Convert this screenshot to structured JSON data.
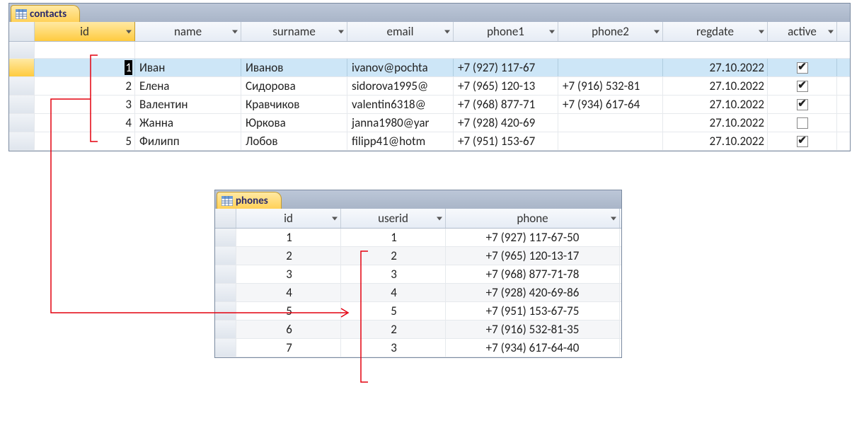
{
  "contacts": {
    "tab_label": "contacts",
    "columns": {
      "id": "id",
      "name": "name",
      "surname": "surname",
      "email": "email",
      "phone1": "phone1",
      "phone2": "phone2",
      "regdate": "regdate",
      "active": "active"
    },
    "rows": [
      {
        "id": "1",
        "name": "Иван",
        "surname": "Иванов",
        "email": "ivanov@pochta",
        "phone1": "+7 (927) 117-67",
        "phone2": "",
        "regdate": "27.10.2022",
        "active": true,
        "selected": true
      },
      {
        "id": "2",
        "name": "Елена",
        "surname": "Сидорова",
        "email": "sidorova1995@",
        "phone1": "+7 (965) 120-13",
        "phone2": "+7 (916) 532-81",
        "regdate": "27.10.2022",
        "active": true,
        "selected": false
      },
      {
        "id": "3",
        "name": "Валентин",
        "surname": "Кравчиков",
        "email": "valentin6318@",
        "phone1": "+7 (968) 877-71",
        "phone2": "+7 (934) 617-64",
        "regdate": "27.10.2022",
        "active": true,
        "selected": false
      },
      {
        "id": "4",
        "name": "Жанна",
        "surname": "Юркова",
        "email": "janna1980@yar",
        "phone1": "+7 (928) 420-69",
        "phone2": "",
        "regdate": "27.10.2022",
        "active": false,
        "selected": false
      },
      {
        "id": "5",
        "name": "Филипп",
        "surname": "Лобов",
        "email": "filipp41@hotm",
        "phone1": "+7 (951) 153-67",
        "phone2": "",
        "regdate": "27.10.2022",
        "active": true,
        "selected": false
      }
    ]
  },
  "phones": {
    "tab_label": "phones",
    "columns": {
      "id": "id",
      "userid": "userid",
      "phone": "phone"
    },
    "rows": [
      {
        "id": "1",
        "userid": "1",
        "phone": "+7 (927) 117-67-50"
      },
      {
        "id": "2",
        "userid": "2",
        "phone": "+7 (965) 120-13-17"
      },
      {
        "id": "3",
        "userid": "3",
        "phone": "+7 (968) 877-71-78"
      },
      {
        "id": "4",
        "userid": "4",
        "phone": "+7 (928) 420-69-86"
      },
      {
        "id": "5",
        "userid": "5",
        "phone": "+7 (951) 153-67-75"
      },
      {
        "id": "6",
        "userid": "2",
        "phone": "+7 (916) 532-81-35"
      },
      {
        "id": "7",
        "userid": "3",
        "phone": "+7 (934) 617-64-40"
      }
    ]
  },
  "checkmark": "✔"
}
